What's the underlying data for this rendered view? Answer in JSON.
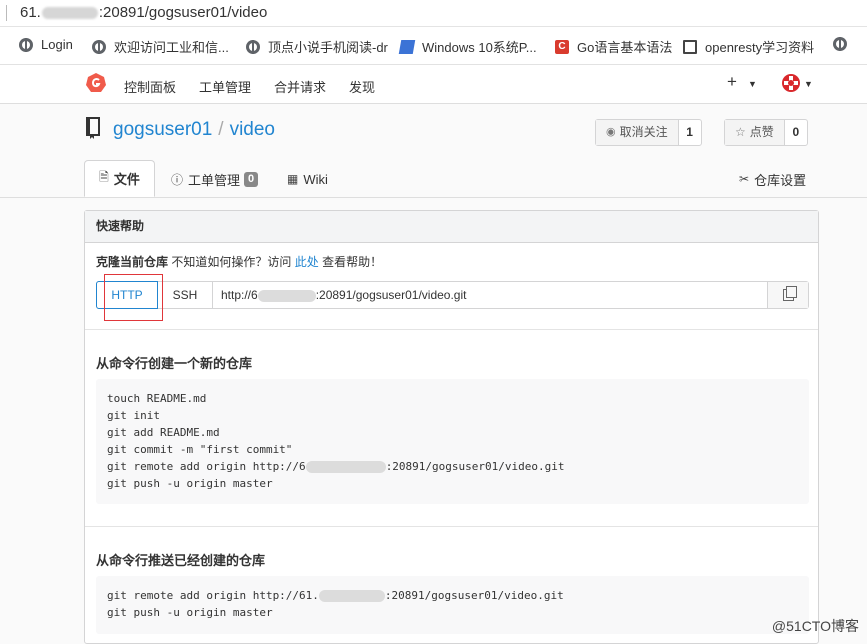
{
  "browser": {
    "url_prefix": "61.",
    "url_suffix": ":20891/gogsuser01/video",
    "bookmarks": [
      {
        "label": "Login",
        "icon": "globe-icon"
      },
      {
        "label": "欢迎访问工业和信...",
        "icon": "globe-icon"
      },
      {
        "label": "顶点小说手机阅读-dr",
        "icon": "globe-icon"
      },
      {
        "label": "Windows 10系统P...",
        "icon": "blue-doc-icon"
      },
      {
        "label": "Go语言基本语法",
        "icon": "red-c-icon"
      },
      {
        "label": "openresty学习资料",
        "icon": "book-icon"
      }
    ]
  },
  "nav": {
    "items": [
      "控制面板",
      "工单管理",
      "合并请求",
      "发现"
    ],
    "plus": "+"
  },
  "repo": {
    "owner": "gogsuser01",
    "separator": "/",
    "name": "video",
    "watch_label": "取消关注",
    "watch_count": "1",
    "star_label": "点赞",
    "star_count": "0"
  },
  "tabs": {
    "files": "文件",
    "issues": "工单管理",
    "issues_count": "0",
    "wiki": "Wiki",
    "settings": "仓库设置"
  },
  "quick_help": {
    "title": "快速帮助",
    "clone_title": "克隆当前仓库",
    "clone_desc": "不知道如何操作？访问",
    "clone_link": "此处",
    "clone_after": "查看帮助！",
    "http_label": "HTTP",
    "ssh_label": "SSH",
    "url_prefix": "http://6",
    "url_suffix": ":20891/gogsuser01/video.git",
    "new_repo_title": "从命令行创建一个新的仓库",
    "new_repo_cmds": [
      "touch README.md",
      "git init",
      "git add README.md",
      "git commit -m \"first commit\"",
      "git remote add origin http://6",
      "git push -u origin master"
    ],
    "new_repo_remote_suffix": ":20891/gogsuser01/video.git",
    "push_title": "从命令行推送已经创建的仓库",
    "push_remote_prefix": "git remote add origin http://61.",
    "push_remote_suffix": ":20891/gogsuser01/video.git",
    "push_cmd": "git push -u origin master"
  },
  "watermark": "@51CTO博客",
  "colors": {
    "link": "#2185d0",
    "highlight": "#e0363a"
  }
}
